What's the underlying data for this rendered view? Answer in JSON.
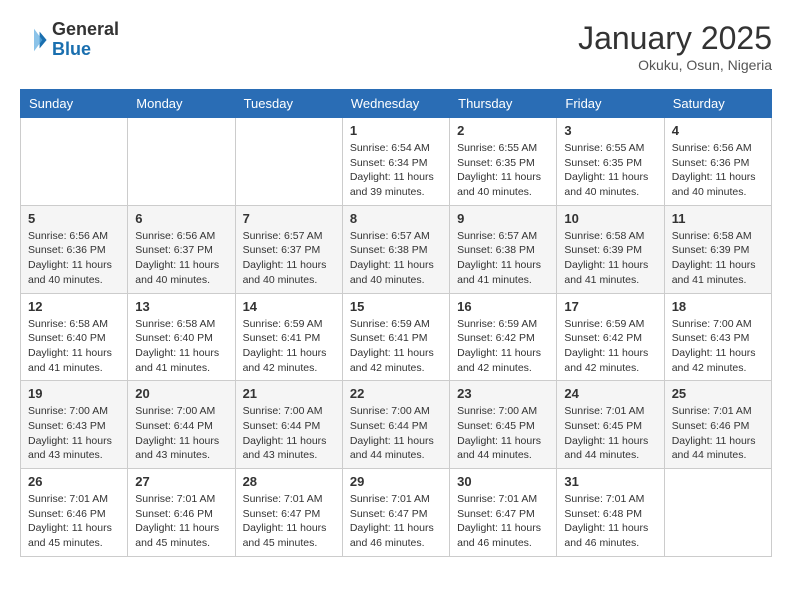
{
  "header": {
    "logo_general": "General",
    "logo_blue": "Blue",
    "month_title": "January 2025",
    "location": "Okuku, Osun, Nigeria"
  },
  "days_of_week": [
    "Sunday",
    "Monday",
    "Tuesday",
    "Wednesday",
    "Thursday",
    "Friday",
    "Saturday"
  ],
  "weeks": [
    [
      {
        "day": "",
        "info": ""
      },
      {
        "day": "",
        "info": ""
      },
      {
        "day": "",
        "info": ""
      },
      {
        "day": "1",
        "info": "Sunrise: 6:54 AM\nSunset: 6:34 PM\nDaylight: 11 hours and 39 minutes."
      },
      {
        "day": "2",
        "info": "Sunrise: 6:55 AM\nSunset: 6:35 PM\nDaylight: 11 hours and 40 minutes."
      },
      {
        "day": "3",
        "info": "Sunrise: 6:55 AM\nSunset: 6:35 PM\nDaylight: 11 hours and 40 minutes."
      },
      {
        "day": "4",
        "info": "Sunrise: 6:56 AM\nSunset: 6:36 PM\nDaylight: 11 hours and 40 minutes."
      }
    ],
    [
      {
        "day": "5",
        "info": "Sunrise: 6:56 AM\nSunset: 6:36 PM\nDaylight: 11 hours and 40 minutes."
      },
      {
        "day": "6",
        "info": "Sunrise: 6:56 AM\nSunset: 6:37 PM\nDaylight: 11 hours and 40 minutes."
      },
      {
        "day": "7",
        "info": "Sunrise: 6:57 AM\nSunset: 6:37 PM\nDaylight: 11 hours and 40 minutes."
      },
      {
        "day": "8",
        "info": "Sunrise: 6:57 AM\nSunset: 6:38 PM\nDaylight: 11 hours and 40 minutes."
      },
      {
        "day": "9",
        "info": "Sunrise: 6:57 AM\nSunset: 6:38 PM\nDaylight: 11 hours and 41 minutes."
      },
      {
        "day": "10",
        "info": "Sunrise: 6:58 AM\nSunset: 6:39 PM\nDaylight: 11 hours and 41 minutes."
      },
      {
        "day": "11",
        "info": "Sunrise: 6:58 AM\nSunset: 6:39 PM\nDaylight: 11 hours and 41 minutes."
      }
    ],
    [
      {
        "day": "12",
        "info": "Sunrise: 6:58 AM\nSunset: 6:40 PM\nDaylight: 11 hours and 41 minutes."
      },
      {
        "day": "13",
        "info": "Sunrise: 6:58 AM\nSunset: 6:40 PM\nDaylight: 11 hours and 41 minutes."
      },
      {
        "day": "14",
        "info": "Sunrise: 6:59 AM\nSunset: 6:41 PM\nDaylight: 11 hours and 42 minutes."
      },
      {
        "day": "15",
        "info": "Sunrise: 6:59 AM\nSunset: 6:41 PM\nDaylight: 11 hours and 42 minutes."
      },
      {
        "day": "16",
        "info": "Sunrise: 6:59 AM\nSunset: 6:42 PM\nDaylight: 11 hours and 42 minutes."
      },
      {
        "day": "17",
        "info": "Sunrise: 6:59 AM\nSunset: 6:42 PM\nDaylight: 11 hours and 42 minutes."
      },
      {
        "day": "18",
        "info": "Sunrise: 7:00 AM\nSunset: 6:43 PM\nDaylight: 11 hours and 42 minutes."
      }
    ],
    [
      {
        "day": "19",
        "info": "Sunrise: 7:00 AM\nSunset: 6:43 PM\nDaylight: 11 hours and 43 minutes."
      },
      {
        "day": "20",
        "info": "Sunrise: 7:00 AM\nSunset: 6:44 PM\nDaylight: 11 hours and 43 minutes."
      },
      {
        "day": "21",
        "info": "Sunrise: 7:00 AM\nSunset: 6:44 PM\nDaylight: 11 hours and 43 minutes."
      },
      {
        "day": "22",
        "info": "Sunrise: 7:00 AM\nSunset: 6:44 PM\nDaylight: 11 hours and 44 minutes."
      },
      {
        "day": "23",
        "info": "Sunrise: 7:00 AM\nSunset: 6:45 PM\nDaylight: 11 hours and 44 minutes."
      },
      {
        "day": "24",
        "info": "Sunrise: 7:01 AM\nSunset: 6:45 PM\nDaylight: 11 hours and 44 minutes."
      },
      {
        "day": "25",
        "info": "Sunrise: 7:01 AM\nSunset: 6:46 PM\nDaylight: 11 hours and 44 minutes."
      }
    ],
    [
      {
        "day": "26",
        "info": "Sunrise: 7:01 AM\nSunset: 6:46 PM\nDaylight: 11 hours and 45 minutes."
      },
      {
        "day": "27",
        "info": "Sunrise: 7:01 AM\nSunset: 6:46 PM\nDaylight: 11 hours and 45 minutes."
      },
      {
        "day": "28",
        "info": "Sunrise: 7:01 AM\nSunset: 6:47 PM\nDaylight: 11 hours and 45 minutes."
      },
      {
        "day": "29",
        "info": "Sunrise: 7:01 AM\nSunset: 6:47 PM\nDaylight: 11 hours and 46 minutes."
      },
      {
        "day": "30",
        "info": "Sunrise: 7:01 AM\nSunset: 6:47 PM\nDaylight: 11 hours and 46 minutes."
      },
      {
        "day": "31",
        "info": "Sunrise: 7:01 AM\nSunset: 6:48 PM\nDaylight: 11 hours and 46 minutes."
      },
      {
        "day": "",
        "info": ""
      }
    ]
  ]
}
